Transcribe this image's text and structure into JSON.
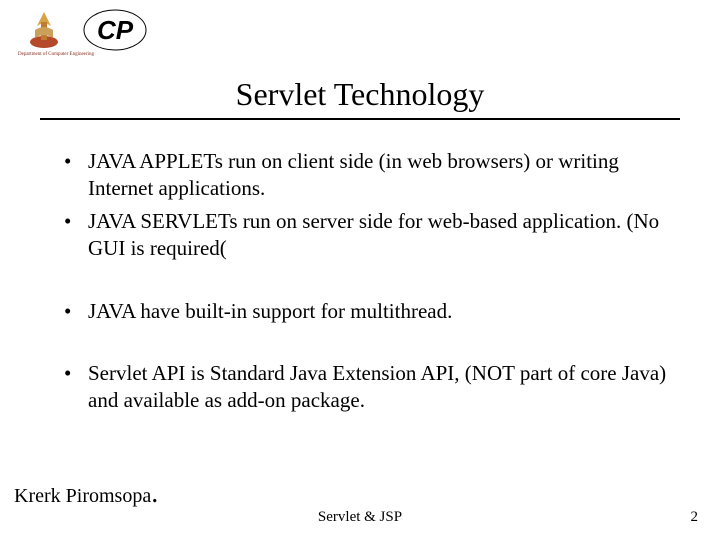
{
  "header": {
    "dept_caption": "Department of Computer Engineering",
    "cp_text": "CP"
  },
  "title": "Servlet Technology",
  "bullets_a": [
    "JAVA APPLETs run on client side (in web browsers) or writing Internet applications.",
    "JAVA SERVLETs run on server side for web-based application. (No GUI is required("
  ],
  "bullets_b": [
    "JAVA have built-in support for multithread."
  ],
  "bullets_c": [
    "Servlet API is Standard Java Extension API, (NOT part of core Java) and available as add-on package."
  ],
  "footer": {
    "author": "Krerk Piromsopa",
    "center": "Servlet & JSP",
    "page": "2"
  }
}
